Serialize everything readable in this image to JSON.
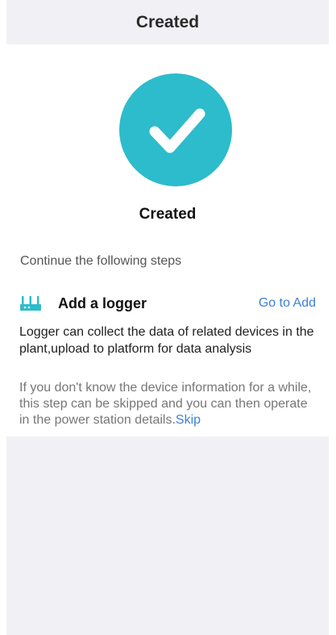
{
  "header": {
    "title": "Created"
  },
  "hero": {
    "status_label": "Created",
    "icon": "checkmark-icon",
    "color": "#2cbccb"
  },
  "steps": {
    "intro": "Continue the following steps",
    "logger": {
      "icon": "router-icon",
      "title": "Add a logger",
      "action_label": "Go to Add",
      "description": "Logger can collect the data of related devices in the plant,upload to platform for data analysis"
    },
    "skip_note": "If you don't know the device information for a while, this step can be skipped and you can then operate in the power station details.",
    "skip_label": "Skip"
  },
  "colors": {
    "accent": "#3b82d6",
    "background": "#f1f0f5"
  }
}
